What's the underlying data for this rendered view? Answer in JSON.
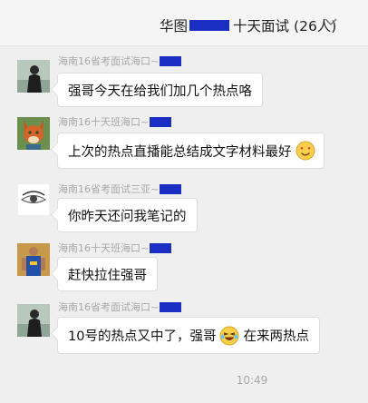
{
  "chat": {
    "title_prefix": "华图",
    "title_suffix": "十天面试",
    "member_count": "(26人)",
    "expand_icon": "chevron-down-icon"
  },
  "messages": [
    {
      "sender": "海南16省考面试海口~",
      "text": "强哥今天在给我们加几个热点咯",
      "avatar": "person-dark-avatar"
    },
    {
      "sender": "海南16十天班海口~",
      "text": "上次的热点直播能总结成文字材料最好",
      "emoji": "heart-eyes-emoji",
      "avatar": "fox-avatar"
    },
    {
      "sender": "海南16省考面试三亚~",
      "text": "你昨天还问我笔记的",
      "avatar": "eye-avatar"
    },
    {
      "sender": "海南16十天班海口~",
      "text": "赶快拉住强哥",
      "avatar": "basketball-player-avatar"
    },
    {
      "sender": "海南16省考面试海口~",
      "text_before": "10号的热点又中了，强哥",
      "emoji": "laughing-emoji",
      "text_after": "在来两热点",
      "avatar": "person-dark-avatar"
    }
  ],
  "timestamp": "10:49",
  "colors": {
    "background": "#efefef",
    "bubble": "#ffffff",
    "redaction": "#1b2ec4",
    "meta_text": "#a8a8a8"
  }
}
